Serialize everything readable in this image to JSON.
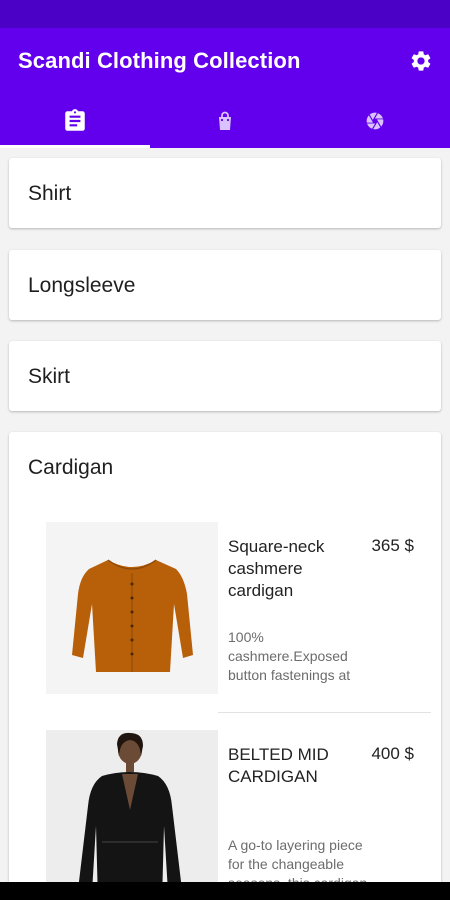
{
  "app": {
    "title": "Scandi Clothing Collection"
  },
  "icons": {
    "settings": "gear-icon",
    "tab1": "clipboard-icon",
    "tab2": "shopping-bag-icon",
    "tab3": "aperture-icon"
  },
  "colors": {
    "primary": "#6200ee",
    "status_bar": "#4b02c6"
  },
  "categories": [
    {
      "label": "Shirt"
    },
    {
      "label": "Longsleeve"
    },
    {
      "label": "Skirt"
    },
    {
      "label": "Cardigan"
    }
  ],
  "products": [
    {
      "name": "Square-neck cashmere cardigan",
      "price": "365 $",
      "description": "100% cashmere.Exposed button fastenings at"
    },
    {
      "name": "BELTED MID CARDIGAN",
      "price": "400 $",
      "description": "A go-to layering piece for the changeable seasons, this cardigan"
    }
  ]
}
